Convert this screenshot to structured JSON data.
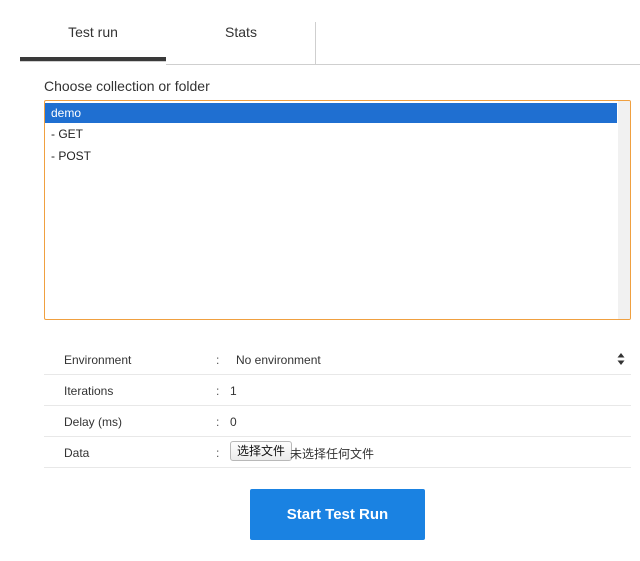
{
  "tabs": [
    {
      "label": "Test run",
      "active": true
    },
    {
      "label": "Stats",
      "active": false
    }
  ],
  "chooser": {
    "label": "Choose collection or folder",
    "items": [
      {
        "label": "demo",
        "selected": true
      },
      {
        "label": "- GET",
        "selected": false
      },
      {
        "label": "- POST",
        "selected": false
      }
    ]
  },
  "settings": {
    "colon": ":",
    "environment": {
      "label": "Environment",
      "value": "No environment",
      "icon": "sort-icon"
    },
    "iterations": {
      "label": "Iterations",
      "value": "1"
    },
    "delay": {
      "label": "Delay (ms)",
      "value": "0"
    },
    "data": {
      "label": "Data",
      "button_label": "选择文件",
      "status": "未选择任何文件"
    }
  },
  "start_button": {
    "label": "Start Test Run"
  },
  "colors": {
    "accent": "#1a82e2",
    "selection": "#1f6fd1",
    "focus_border": "#f0a040"
  }
}
